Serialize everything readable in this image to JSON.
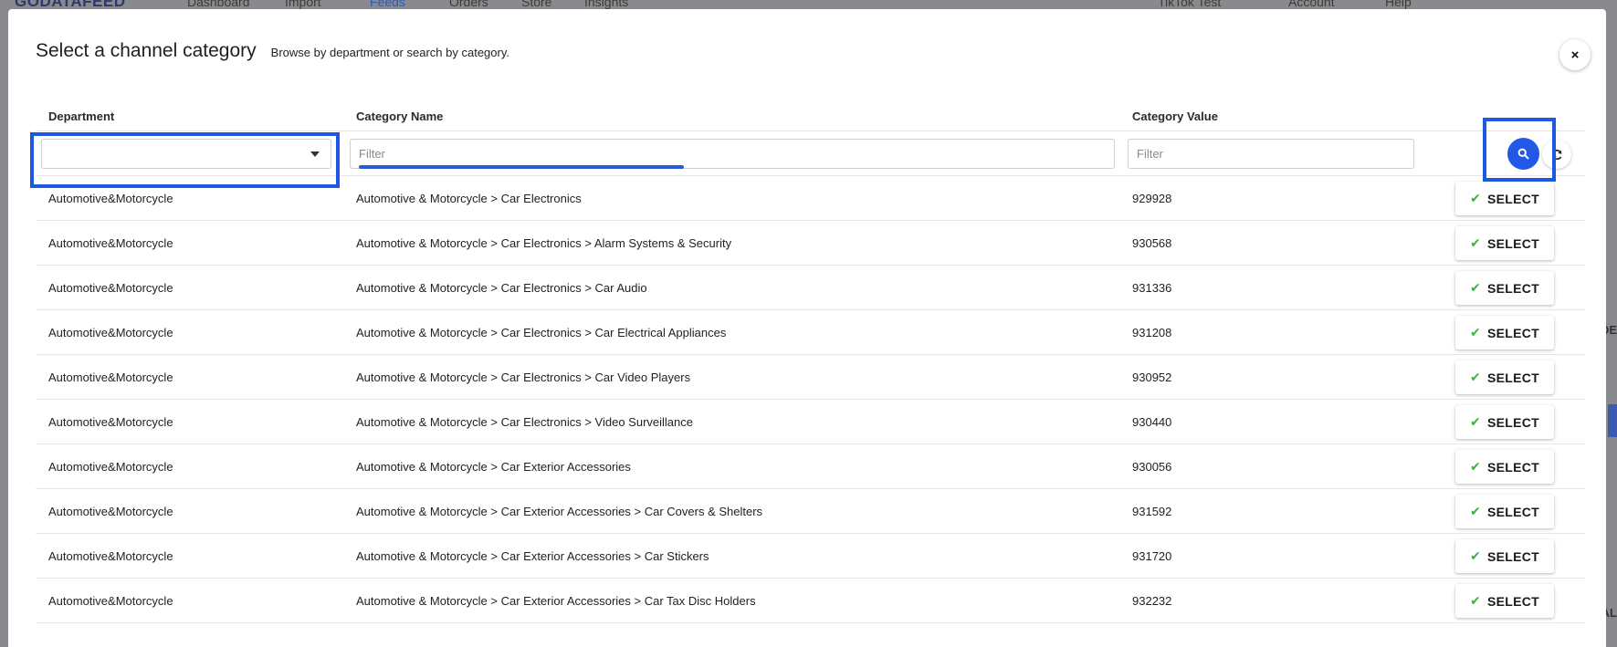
{
  "background": {
    "logo": "GODATAFEED",
    "nav": [
      "Dashboard",
      "Import",
      "Feeds",
      "Orders",
      "Store",
      "Insights"
    ],
    "right_nav": [
      "TikTok Test",
      "Account",
      "Help"
    ],
    "side_labels": [
      "DE",
      "AL"
    ]
  },
  "modal": {
    "title": "Select a channel category",
    "subtitle": "Browse by department or search by category.",
    "close_label": "×"
  },
  "columns": {
    "department": "Department",
    "category_name": "Category Name",
    "category_value": "Category Value"
  },
  "filters": {
    "department_value": "",
    "name_placeholder": "Filter",
    "value_placeholder": "Filter"
  },
  "select_label": "SELECT",
  "rows": [
    {
      "department": "Automotive&Motorcycle",
      "name": "Automotive & Motorcycle > Car Electronics",
      "value": "929928"
    },
    {
      "department": "Automotive&Motorcycle",
      "name": "Automotive & Motorcycle > Car Electronics > Alarm Systems & Security",
      "value": "930568"
    },
    {
      "department": "Automotive&Motorcycle",
      "name": "Automotive & Motorcycle > Car Electronics > Car Audio",
      "value": "931336"
    },
    {
      "department": "Automotive&Motorcycle",
      "name": "Automotive & Motorcycle > Car Electronics > Car Electrical Appliances",
      "value": "931208"
    },
    {
      "department": "Automotive&Motorcycle",
      "name": "Automotive & Motorcycle > Car Electronics > Car Video Players",
      "value": "930952"
    },
    {
      "department": "Automotive&Motorcycle",
      "name": "Automotive & Motorcycle > Car Electronics > Video Surveillance",
      "value": "930440"
    },
    {
      "department": "Automotive&Motorcycle",
      "name": "Automotive & Motorcycle > Car Exterior Accessories",
      "value": "930056"
    },
    {
      "department": "Automotive&Motorcycle",
      "name": "Automotive & Motorcycle > Car Exterior Accessories > Car Covers & Shelters",
      "value": "931592"
    },
    {
      "department": "Automotive&Motorcycle",
      "name": "Automotive & Motorcycle > Car Exterior Accessories > Car Stickers",
      "value": "931720"
    },
    {
      "department": "Automotive&Motorcycle",
      "name": "Automotive & Motorcycle > Car Exterior Accessories > Car Tax Disc Holders",
      "value": "932232"
    }
  ],
  "colors": {
    "accent": "#2357e8",
    "highlight": "#1f57e5",
    "check": "#3cb043"
  },
  "icons": {
    "search": "search-icon",
    "refresh": "refresh-icon",
    "close": "close-icon",
    "check": "check-icon",
    "dropdown": "chevron-down-icon"
  }
}
